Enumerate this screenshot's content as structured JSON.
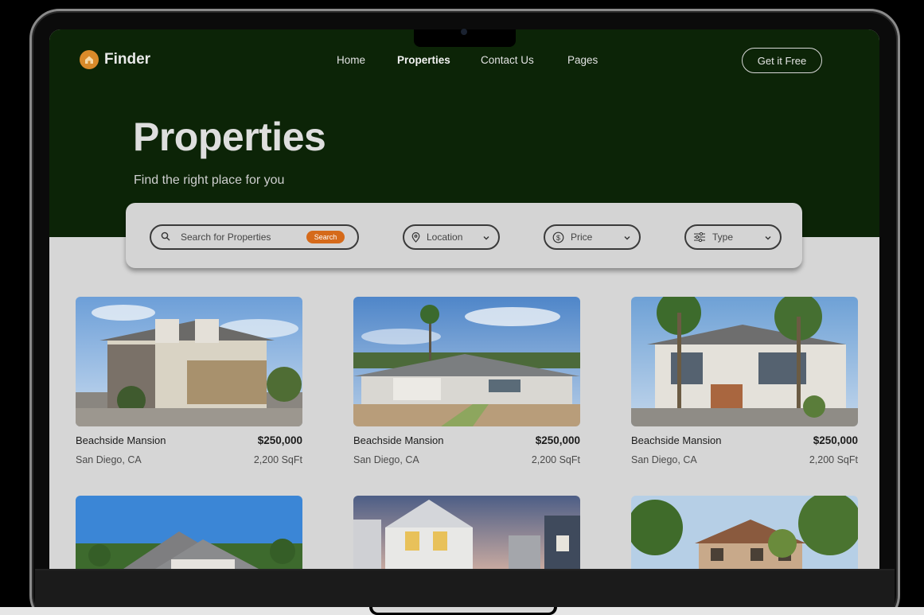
{
  "header": {
    "brand": "Finder",
    "nav": [
      {
        "label": "Home",
        "active": false
      },
      {
        "label": "Properties",
        "active": true
      },
      {
        "label": "Contact Us",
        "active": false
      },
      {
        "label": "Pages",
        "active": false
      }
    ],
    "cta_label": "Get it Free"
  },
  "hero": {
    "title": "Properties",
    "subtitle": "Find the right place for you"
  },
  "filters": {
    "search_placeholder": "Search for Properties",
    "search_button": "Search",
    "location_label": "Location",
    "price_label": "Price",
    "type_label": "Type"
  },
  "listings": [
    {
      "name": "Beachside Mansion",
      "price": "$250,000",
      "location": "San Diego, CA",
      "area": "2,200 SqFt"
    },
    {
      "name": "Beachside Mansion",
      "price": "$250,000",
      "location": "San Diego, CA",
      "area": "2,200 SqFt"
    },
    {
      "name": "Beachside Mansion",
      "price": "$250,000",
      "location": "San Diego, CA",
      "area": "2,200 SqFt"
    }
  ],
  "colors": {
    "hero_bg": "#0c2407",
    "accent": "#d56a1a",
    "brand_mark": "#d98a2a",
    "page_bg": "#d6d6d6"
  },
  "icons": [
    "home-icon",
    "search-icon",
    "location-pin-icon",
    "dollar-icon",
    "sliders-icon",
    "chevron-down-icon"
  ]
}
